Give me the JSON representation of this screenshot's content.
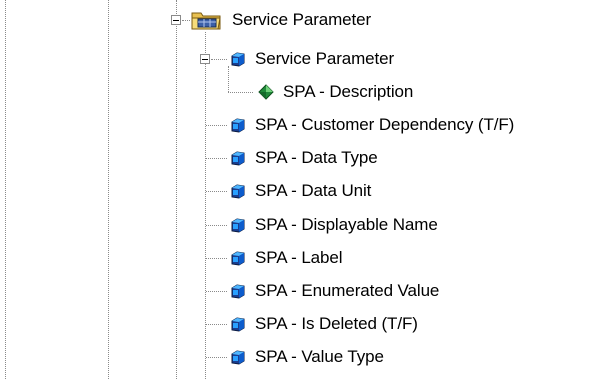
{
  "tree": {
    "root": {
      "label": "Service Parameter",
      "icon": "folder-with-table-icon",
      "child": {
        "label": "Service Parameter",
        "icon": "entity-cube-icon",
        "child": {
          "label": "SPA - Description",
          "icon": "green-diamond-key-icon"
        }
      },
      "attributes": [
        {
          "label": "SPA - Customer Dependency (T/F)",
          "icon": "entity-cube-icon"
        },
        {
          "label": "SPA - Data Type",
          "icon": "entity-cube-icon"
        },
        {
          "label": "SPA - Data Unit",
          "icon": "entity-cube-icon"
        },
        {
          "label": "SPA - Displayable Name",
          "icon": "entity-cube-icon"
        },
        {
          "label": "SPA - Label",
          "icon": "entity-cube-icon"
        },
        {
          "label": "SPA - Enumerated Value",
          "icon": "entity-cube-icon"
        },
        {
          "label": "SPA - Is Deleted (T/F)",
          "icon": "entity-cube-icon"
        },
        {
          "label": "SPA - Value Type",
          "icon": "entity-cube-icon"
        }
      ]
    }
  }
}
